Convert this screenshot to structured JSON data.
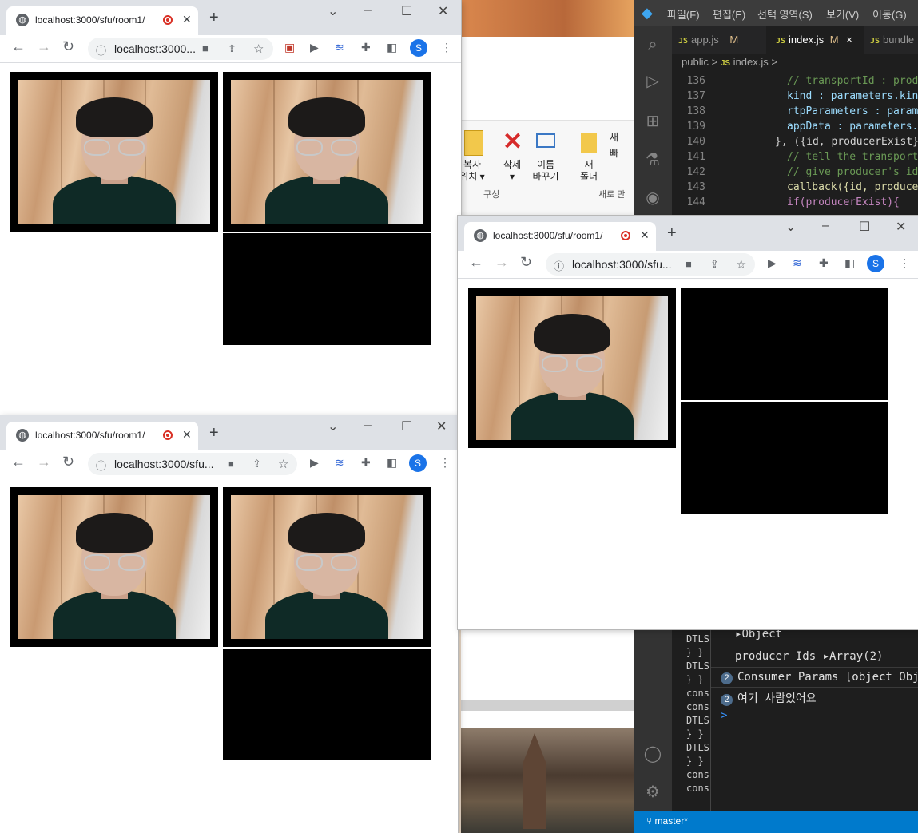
{
  "vscode": {
    "menu": [
      "파일(F)",
      "편집(E)",
      "선택 영역(S)",
      "보기(V)",
      "이동(G)"
    ],
    "tabs": [
      {
        "file": "app.js",
        "status": "M",
        "active": false
      },
      {
        "file": "index.js",
        "status": "M",
        "active": true
      },
      {
        "file": "bundle",
        "status": "",
        "active": false
      }
    ],
    "close_glyph": "×",
    "breadcrumb": {
      "folder": "public",
      "sep": ">",
      "file": "index.js"
    },
    "lines": [
      {
        "n": "136",
        "text": "// transportId : produ"
      },
      {
        "n": "137",
        "text": "kind : parameters.kind"
      },
      {
        "n": "138",
        "text": "rtpParameters : parame"
      },
      {
        "n": "139",
        "text": "appData : parameters.a"
      },
      {
        "n": "140",
        "text": "}, ({id, producerExist}"
      },
      {
        "n": "141",
        "text": "// tell the transport"
      },
      {
        "n": "142",
        "text": "// give producer's id"
      },
      {
        "n": "143",
        "text": "callback({id, producer"
      },
      {
        "n": "144",
        "text": "if(producerExist){"
      }
    ],
    "terminal_left": [
      "DTLS",
      "} }",
      "DTLS",
      "} }",
      "cons",
      "cons",
      "DTLS",
      "} }",
      "DTLS",
      "} }",
      "cons",
      "cons"
    ],
    "debug": {
      "object_label": "Object",
      "producer_label": "producer Ids",
      "producer_value": "Array(2)",
      "consumer_count": "2",
      "consumer_text": "Consumer Params [object Obj",
      "korean_count": "2",
      "korean_text": "여기 사람있어요",
      "prompt": ">"
    },
    "status_branch": "master*"
  },
  "explorer": {
    "ribbon": [
      {
        "label": "복사\n위치 ▾"
      },
      {
        "label": "삭제\n▾"
      },
      {
        "label": "이름\n바꾸기"
      },
      {
        "label": "새\n폴더"
      }
    ],
    "small_items": [
      "새",
      "빠"
    ],
    "group_organize": "구성",
    "group_new": "새로 만"
  },
  "browser": {
    "tab_title": "localhost:3000/sfu/room1/",
    "url_full": "localhost:3000...",
    "url_short": "localhost:3000/sfu...",
    "avatar_letter": "S",
    "new_tab": "+",
    "close_tab": "✕"
  }
}
